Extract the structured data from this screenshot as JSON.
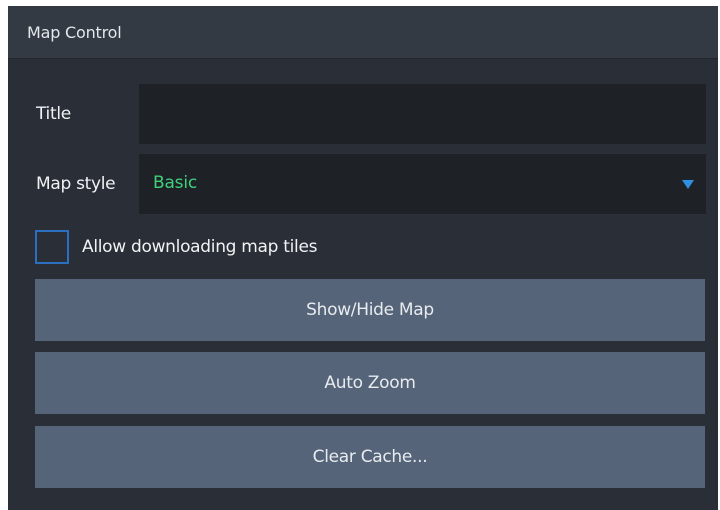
{
  "panel": {
    "title": "Map Control"
  },
  "fields": {
    "title_label": "Title",
    "title_value": "",
    "map_style_label": "Map style",
    "map_style_value": "Basic"
  },
  "options": {
    "allow_download_label": "Allow downloading map tiles",
    "allow_download_checked": false
  },
  "buttons": {
    "show_hide": "Show/Hide Map",
    "auto_zoom": "Auto Zoom",
    "clear_cache": "Clear Cache..."
  },
  "colors": {
    "panel_bg": "#2a2f37",
    "header_bg": "#343a44",
    "field_bg": "#1e2227",
    "button_bg": "#556479",
    "accent_green": "#3fd17a",
    "accent_blue": "#2f8fe0"
  }
}
